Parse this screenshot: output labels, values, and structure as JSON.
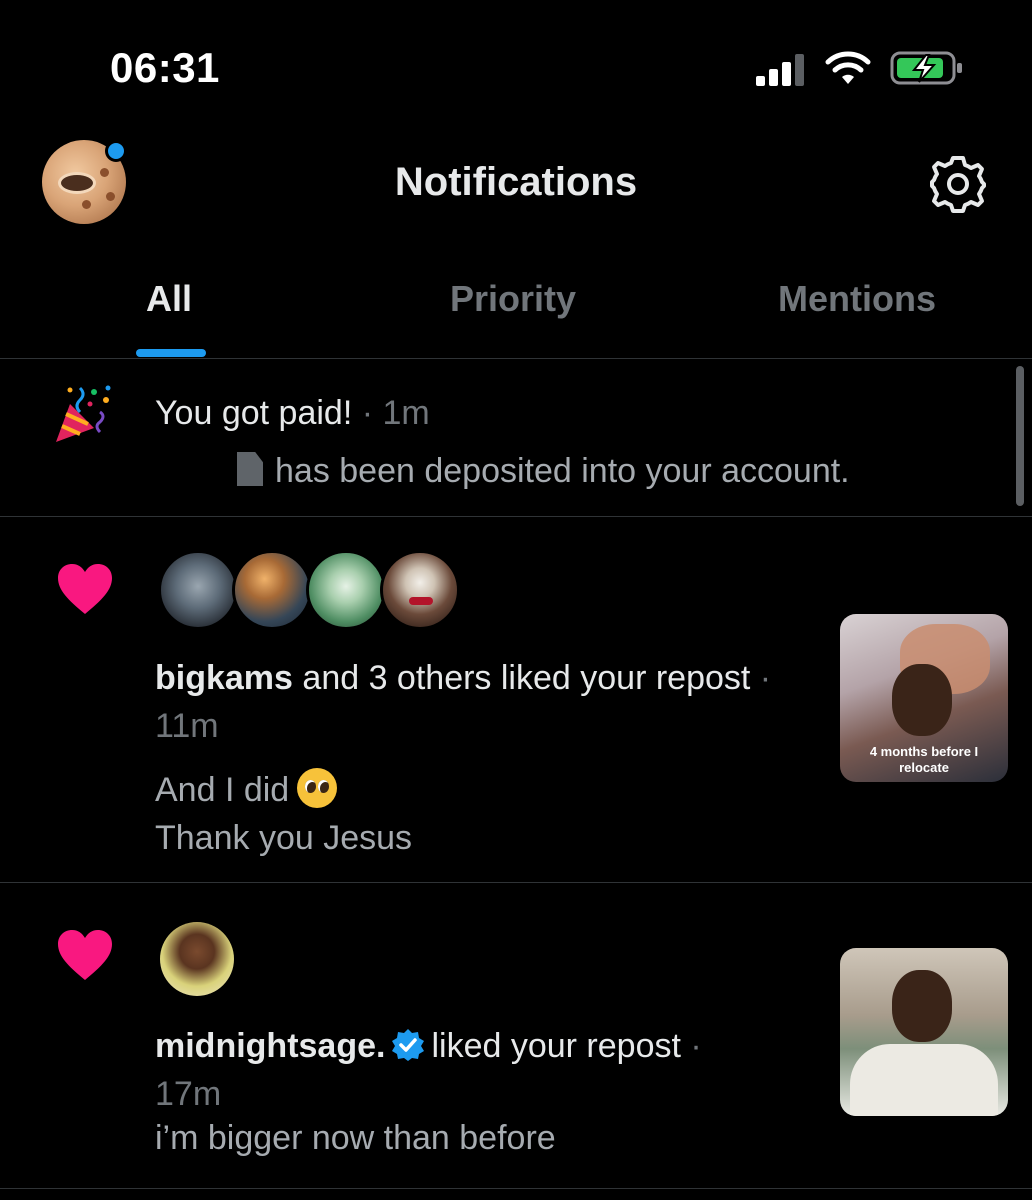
{
  "status_bar": {
    "time": "06:31",
    "signal_icon": "cellular-signal-icon",
    "wifi_icon": "wifi-icon",
    "battery_icon": "battery-charging-icon"
  },
  "header": {
    "title": "Notifications",
    "settings_icon": "gear-icon"
  },
  "tabs": [
    {
      "label": "All",
      "active": true
    },
    {
      "label": "Priority",
      "active": false
    },
    {
      "label": "Mentions",
      "active": false
    }
  ],
  "notifications": [
    {
      "type": "payment",
      "icon": "party-popper-icon",
      "title": "You got paid!",
      "time": "· 1m",
      "body": "has been deposited into your account."
    },
    {
      "type": "like",
      "icon": "heart-icon",
      "user": "bigkams",
      "action": "and 3 others liked your repost",
      "time": "· 11m",
      "post_lines": [
        "And I did",
        "Thank you Jesus"
      ],
      "thumbnail_text": [
        "4 months before I",
        "relocate"
      ]
    },
    {
      "type": "like",
      "icon": "heart-icon",
      "user": "midnightsage.",
      "verified": true,
      "action": "liked your repost",
      "time": "·",
      "time_line2": "17m",
      "post_lines": [
        "i’m bigger now than before"
      ]
    }
  ],
  "colors": {
    "background": "#000000",
    "accent": "#1d9bf0",
    "like": "#f91880",
    "text_primary": "#e7e9ea",
    "text_secondary": "#71767b",
    "divider": "#2f3336"
  }
}
